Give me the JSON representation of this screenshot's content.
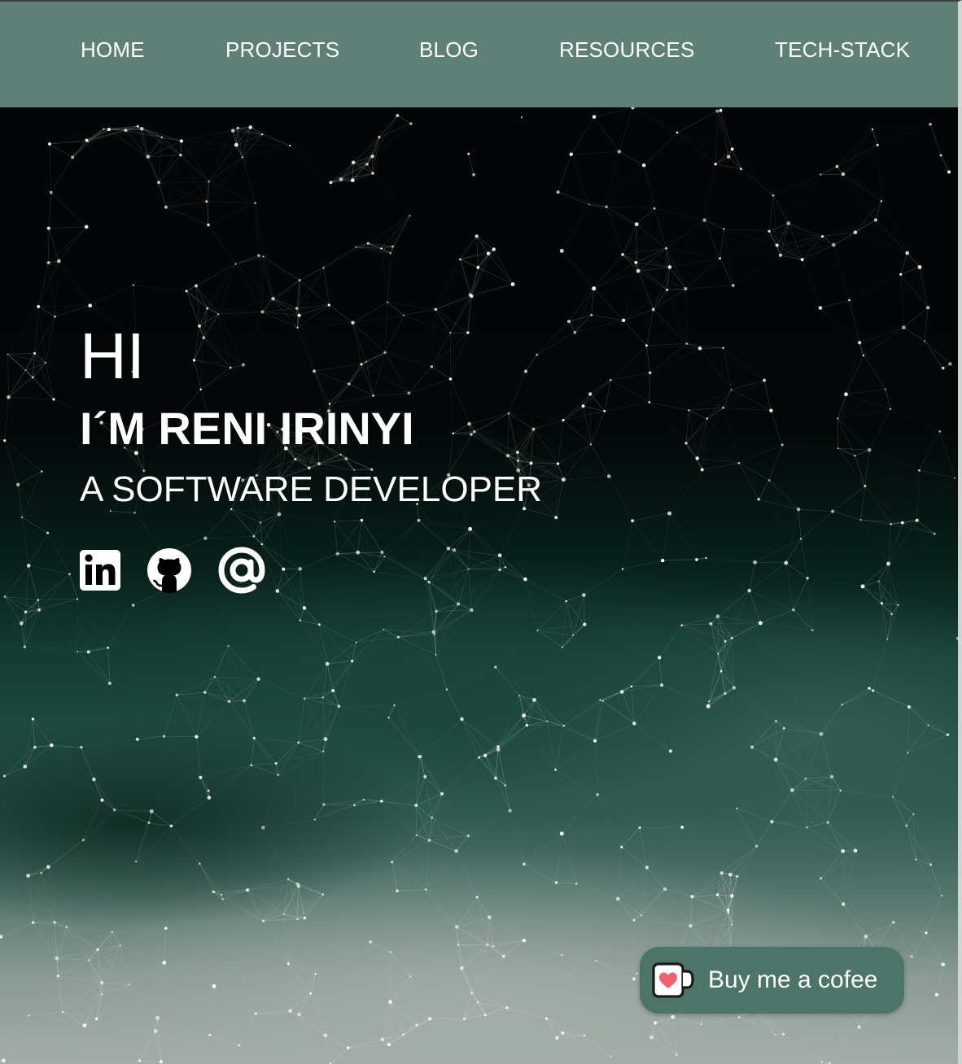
{
  "nav": {
    "items": [
      {
        "label": "HOME"
      },
      {
        "label": "PROJECTS"
      },
      {
        "label": "BLOG"
      },
      {
        "label": "RESOURCES"
      },
      {
        "label": "TECH-STACK"
      }
    ]
  },
  "hero": {
    "greeting": "HI",
    "name": "I´M RENI IRINYI",
    "role": "A SOFTWARE DEVELOPER"
  },
  "social": {
    "icons": [
      "linkedin-icon",
      "github-icon",
      "at-sign-icon"
    ]
  },
  "coffee": {
    "label": "Buy me a cofee",
    "icon": "coffee-cup-heart-icon"
  },
  "colors": {
    "navbar": "#5e8077",
    "coffee_button": "#4c7468",
    "text": "#ffffff",
    "heart": "#f0626c"
  }
}
